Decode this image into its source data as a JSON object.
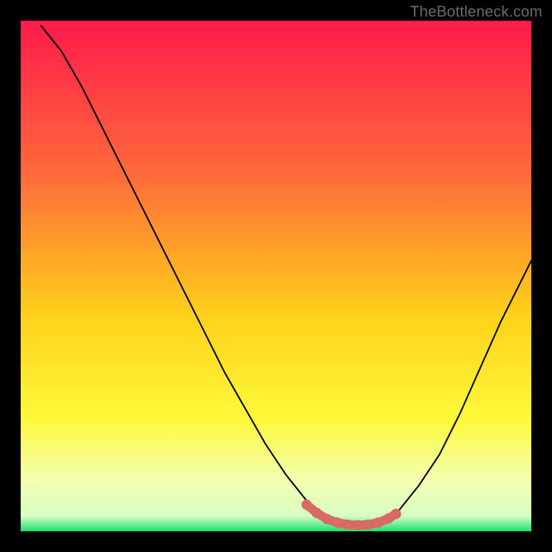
{
  "watermark": "TheBottleneck.com",
  "colors": {
    "top": "#ff1a4b",
    "mid1": "#ff6a3a",
    "mid2": "#ffd21a",
    "mid3": "#fff93a",
    "pale": "#f3ffb0",
    "green": "#18e072",
    "black": "#000000",
    "curve": "#000000",
    "node": "#d86a62"
  },
  "chart_data": {
    "type": "line",
    "title": "",
    "xlabel": "",
    "ylabel": "",
    "xlim": [
      0,
      100
    ],
    "ylim": [
      0,
      100
    ],
    "series": [
      {
        "name": "bottleneck-curve",
        "x": [
          4,
          8,
          12,
          16,
          20,
          24,
          28,
          32,
          36,
          40,
          44,
          48,
          52,
          56,
          58,
          60,
          62,
          64,
          66,
          68,
          70,
          74,
          78,
          82,
          86,
          90,
          94,
          98,
          100
        ],
        "y": [
          99,
          94,
          87,
          79,
          71,
          63,
          55,
          47,
          39,
          31,
          24,
          17,
          11,
          6,
          4,
          2.5,
          1.8,
          1.3,
          1.2,
          1.3,
          1.8,
          4,
          9,
          15,
          23,
          32,
          41,
          49,
          53
        ]
      }
    ],
    "highlight_nodes": {
      "name": "sweet-spot",
      "x": [
        56,
        58,
        60,
        62,
        64,
        66,
        68,
        70,
        72,
        73.5
      ],
      "y": [
        5.2,
        3.6,
        2.4,
        1.7,
        1.3,
        1.2,
        1.3,
        1.7,
        2.5,
        3.4
      ]
    }
  }
}
